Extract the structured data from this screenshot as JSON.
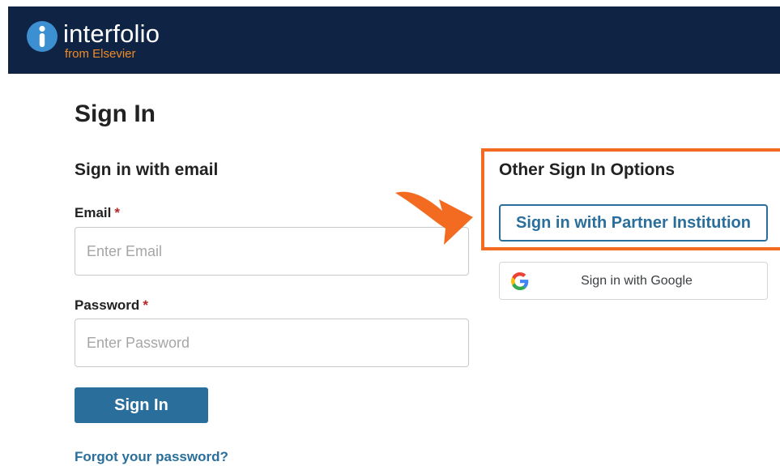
{
  "header": {
    "brand": "interfolio",
    "brand_sub": "from Elsevier"
  },
  "page_title": "Sign In",
  "email_section": {
    "title": "Sign in with email",
    "email_label": "Email",
    "email_placeholder": "Enter Email",
    "password_label": "Password",
    "password_placeholder": "Enter Password",
    "required_mark": "*",
    "submit_label": "Sign In",
    "forgot_link": "Forgot your password?"
  },
  "other_section": {
    "title": "Other Sign In Options",
    "partner_button": "Sign in with Partner Institution",
    "google_button": "Sign in with Google"
  },
  "colors": {
    "header_bg": "#0f2444",
    "brand_accent": "#f08a24",
    "primary": "#2a6f9c",
    "highlight": "#f26b21",
    "required": "#b52727"
  },
  "icons": {
    "logo": "interfolio-info-logo-icon",
    "google": "google-g-icon",
    "callout": "curved-arrow-icon"
  }
}
